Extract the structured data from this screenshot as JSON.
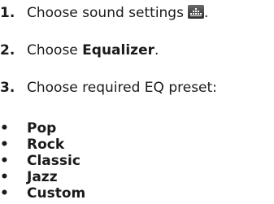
{
  "steps": [
    {
      "number": "1.",
      "text": "Choose sound settings",
      "icon": "sound-settings-icon",
      "period": "."
    },
    {
      "number": "2.",
      "prefix": "Choose ",
      "bold": "Equalizer",
      "suffix": "."
    },
    {
      "number": "3.",
      "text": "Choose required EQ preset:"
    }
  ],
  "bullet": "•",
  "presets": [
    "Pop",
    "Rock",
    "Classic",
    "Jazz",
    "Custom"
  ]
}
